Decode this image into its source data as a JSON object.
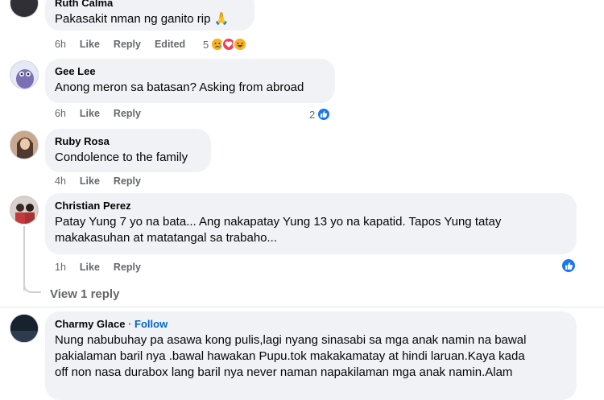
{
  "comments": [
    {
      "author": "Ruth Calma",
      "text": "Pakasakit nman ng ganito rip 🙏",
      "time": "6h",
      "like": "Like",
      "reply": "Reply",
      "edited": "Edited",
      "reaction_count": "5"
    },
    {
      "author": "Gee Lee",
      "text": "Anong meron sa batasan? Asking from abroad",
      "time": "6h",
      "like": "Like",
      "reply": "Reply",
      "reaction_count": "2"
    },
    {
      "author": "Ruby Rosa",
      "text": "Condolence to the family",
      "time": "4h",
      "like": "Like",
      "reply": "Reply"
    },
    {
      "author": "Christian Perez",
      "text_line1": "Patay Yung 7 yo na bata... Ang nakapatay Yung 13 yo na kapatid. Tapos Yung tatay",
      "text_line2": "makakasuhan at matatangal sa trabaho...",
      "time": "1h",
      "like": "Like",
      "reply": "Reply",
      "view_replies": "View 1 reply"
    },
    {
      "author": "Charmy Glace",
      "separator": "·",
      "follow": "Follow",
      "text_line1": "Nung nabubuhay pa asawa kong pulis,lagi nyang sinasabi sa mga anak namin na bawal",
      "text_line2": "pakialaman baril nya .bawal hawakan Pupu.tok makakamatay at hindi laruan.Kaya kada",
      "text_line3": "off non nasa durabox lang baril nya never naman napakilaman mga anak namin.Alam"
    }
  ],
  "icons": {
    "like": "like-icon",
    "sad": "sad-emoji-icon",
    "love": "heart-icon",
    "haha": "haha-emoji-icon"
  },
  "colors": {
    "bubble": "#f0f2f5",
    "secondary_text": "#65676b",
    "link": "#0064d1",
    "like_blue": "#1877f2"
  }
}
